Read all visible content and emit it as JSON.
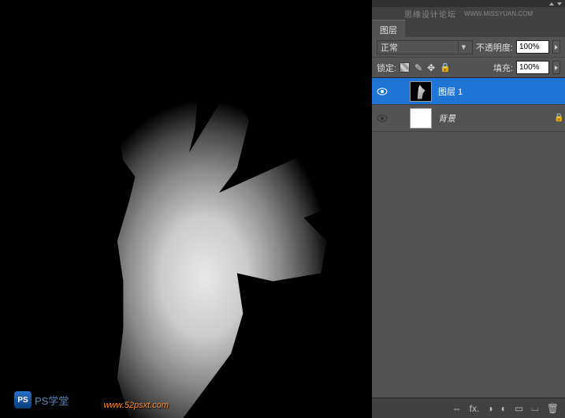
{
  "watermarks": {
    "top_forum": "思缘设计论坛",
    "top_url": "WWW.MISSYUAN.COM",
    "bottom_left_badge": "PS",
    "bottom_left_text": "PS学堂",
    "bottom_right": "www.52psxt.com"
  },
  "panel": {
    "tab": "图层",
    "blend_mode": "正常",
    "opacity_label": "不透明度:",
    "opacity_value": "100%",
    "lock_label": "锁定:",
    "fill_label": "填充:",
    "fill_value": "100%"
  },
  "layers": [
    {
      "name": "图层 1",
      "selected": true,
      "visible": true,
      "thumb": "hand",
      "italic": false,
      "locked": false
    },
    {
      "name": "背景",
      "selected": false,
      "visible": true,
      "thumb": "white",
      "italic": true,
      "locked": true
    }
  ],
  "footer_icons": {
    "link": "⇔",
    "fx": "fx.",
    "mask": "◑",
    "adjust": "◐",
    "folder": "▭",
    "new": "⌴",
    "trash": "🗑"
  }
}
